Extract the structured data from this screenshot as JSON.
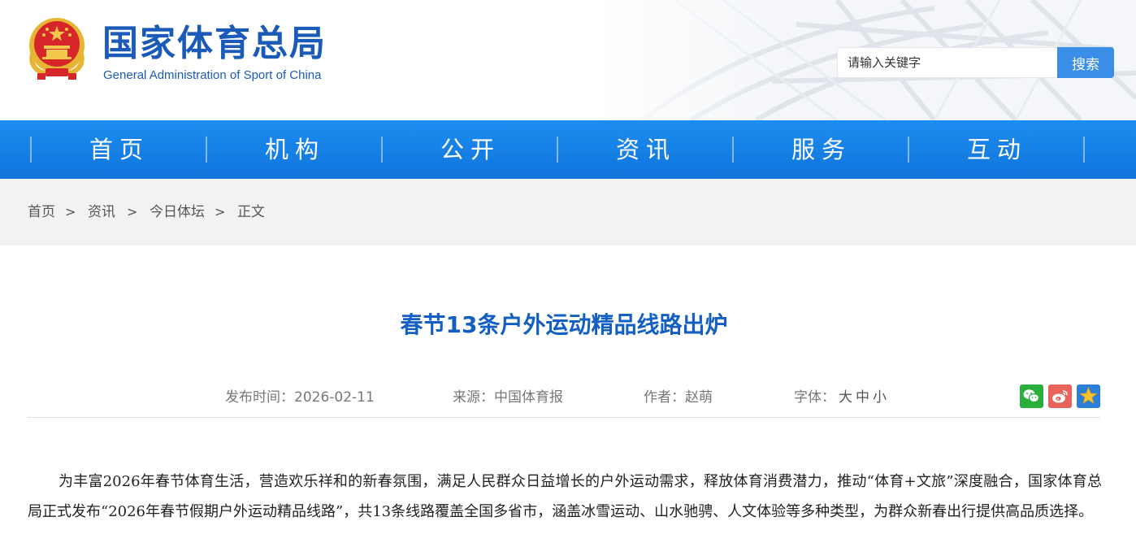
{
  "header": {
    "title_cn": "国家体育总局",
    "title_en": "General Administration of Sport of China",
    "search_placeholder": "请输入关键字",
    "search_button": "搜索"
  },
  "nav": {
    "items": [
      {
        "label": "首页"
      },
      {
        "label": "机构"
      },
      {
        "label": "公开"
      },
      {
        "label": "资讯"
      },
      {
        "label": "服务"
      },
      {
        "label": "互动"
      }
    ]
  },
  "breadcrumb": {
    "items": [
      "首页",
      "资讯",
      "今日体坛",
      "正文"
    ],
    "separator": ">"
  },
  "article": {
    "title": "春节13条户外运动精品线路出炉",
    "publish_label": "发布时间：",
    "publish_date": "2026-02-11",
    "source_label": "来源：",
    "source": "中国体育报",
    "author_label": "作者：",
    "author": "赵萌",
    "font_label": "字体：",
    "font_sizes": [
      "大",
      "中",
      "小"
    ],
    "share": [
      "wechat-icon",
      "weibo-icon",
      "favorite-star-icon"
    ],
    "body": "为丰富2026年春节体育生活，营造欢乐祥和的新春氛围，满足人民群众日益增长的户外运动需求，释放体育消费潜力，推动“体育+文旅”深度融合，国家体育总局正式发布“2026年春节假期户外运动精品线路”，共13条线路覆盖全国多省市，涵盖冰雪运动、山水驰骋、人文体验等多种类型，为群众新春出行提供高品质选择。"
  },
  "colors": {
    "brand_blue": "#1a5ab8",
    "nav_blue": "#1584e8",
    "title_blue": "#1460c2",
    "search_button": "#3b8ee8",
    "wechat_green": "#2aae3c",
    "weibo_red": "#e8645a",
    "star_blue": "#2b7fd8"
  }
}
